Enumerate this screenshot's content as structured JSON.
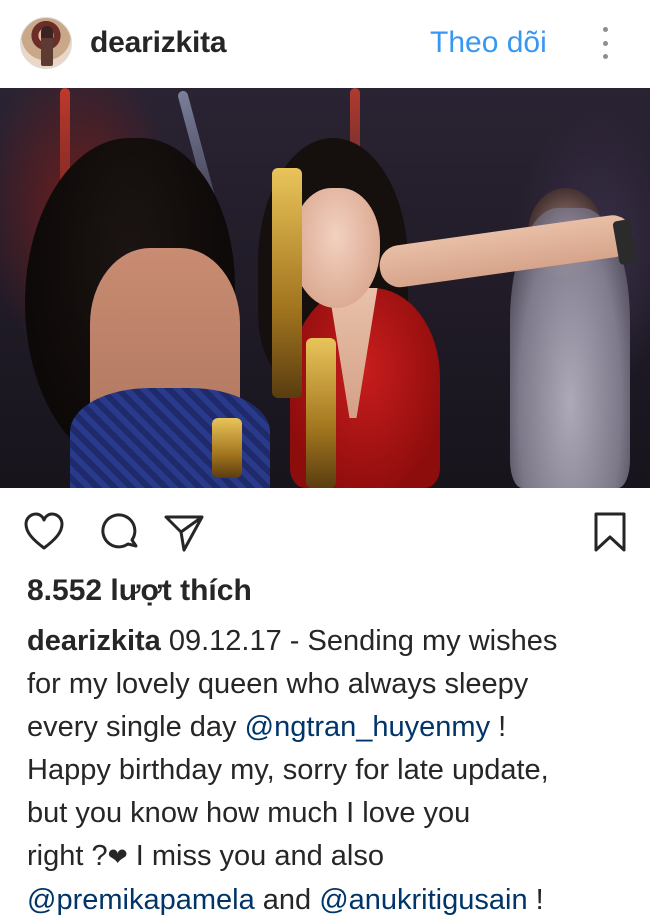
{
  "header": {
    "username": "dearizkita",
    "follow_label": "Theo dõi"
  },
  "post": {
    "likes": "8.552 lượt thích",
    "caption": {
      "username": "dearizkita",
      "line1_text": " 09.12.17 - Sending my wishes",
      "line2_text": "for my lovely queen who always sleepy",
      "line3_text": "every single day ",
      "line3_mention": "@ngtran_huyenmy",
      "line3_tail": " !",
      "line4_text": "Happy birthday my, sorry for late update,",
      "line5_text": "but you know how much I love you",
      "line6_text": "right ?",
      "line6_emoji": "❤",
      "line6_tail": " I miss you and also",
      "line7_mention1": "@premikapamela",
      "line7_middle": " and ",
      "line7_mention2": "@anukritigusain",
      "line7_tail": " !"
    }
  },
  "icons": {
    "like": "heart-icon",
    "comment": "comment-icon",
    "share": "send-icon",
    "save": "bookmark-icon",
    "more": "more-vertical-icon",
    "tag": "user-tag-icon"
  },
  "colors": {
    "link": "#3897f0",
    "mention": "#003569",
    "text": "#262626"
  }
}
